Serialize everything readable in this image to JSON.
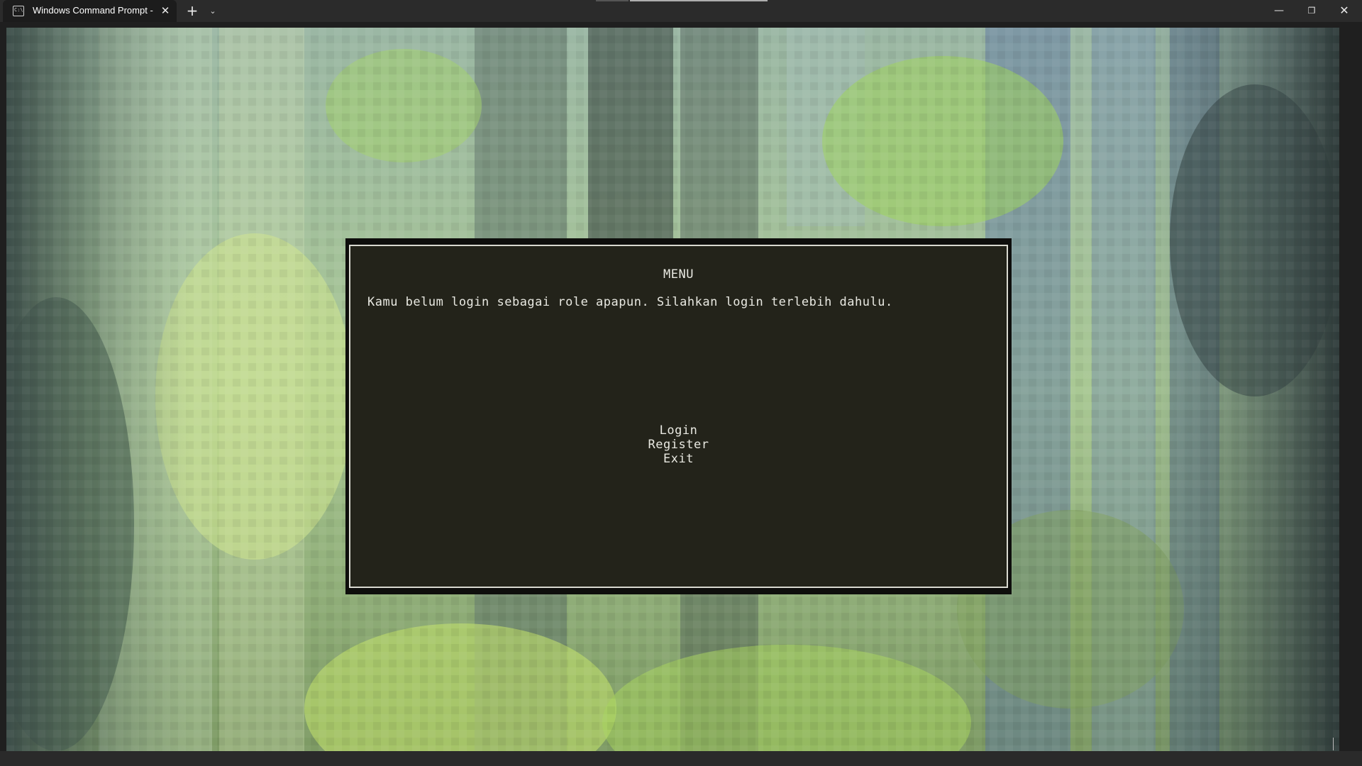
{
  "window": {
    "tab_title": "Windows Command Prompt -",
    "tab_icon": "terminal-icon",
    "new_tab": "+",
    "close_tab": "✕",
    "dropdown": "⌄",
    "minimize": "—",
    "maximize": "❐",
    "close": "✕"
  },
  "menu": {
    "title": "MENU",
    "message": "Kamu belum login sebagai role apapun. Silahkan login terlebih dahulu.",
    "options": [
      "Login",
      "Register",
      "Exit"
    ]
  },
  "colors": {
    "titlebar": "#2b2b2b",
    "menu_background": "#23231a",
    "menu_border": "#d9d9d0",
    "text": "#e9e9e2"
  }
}
